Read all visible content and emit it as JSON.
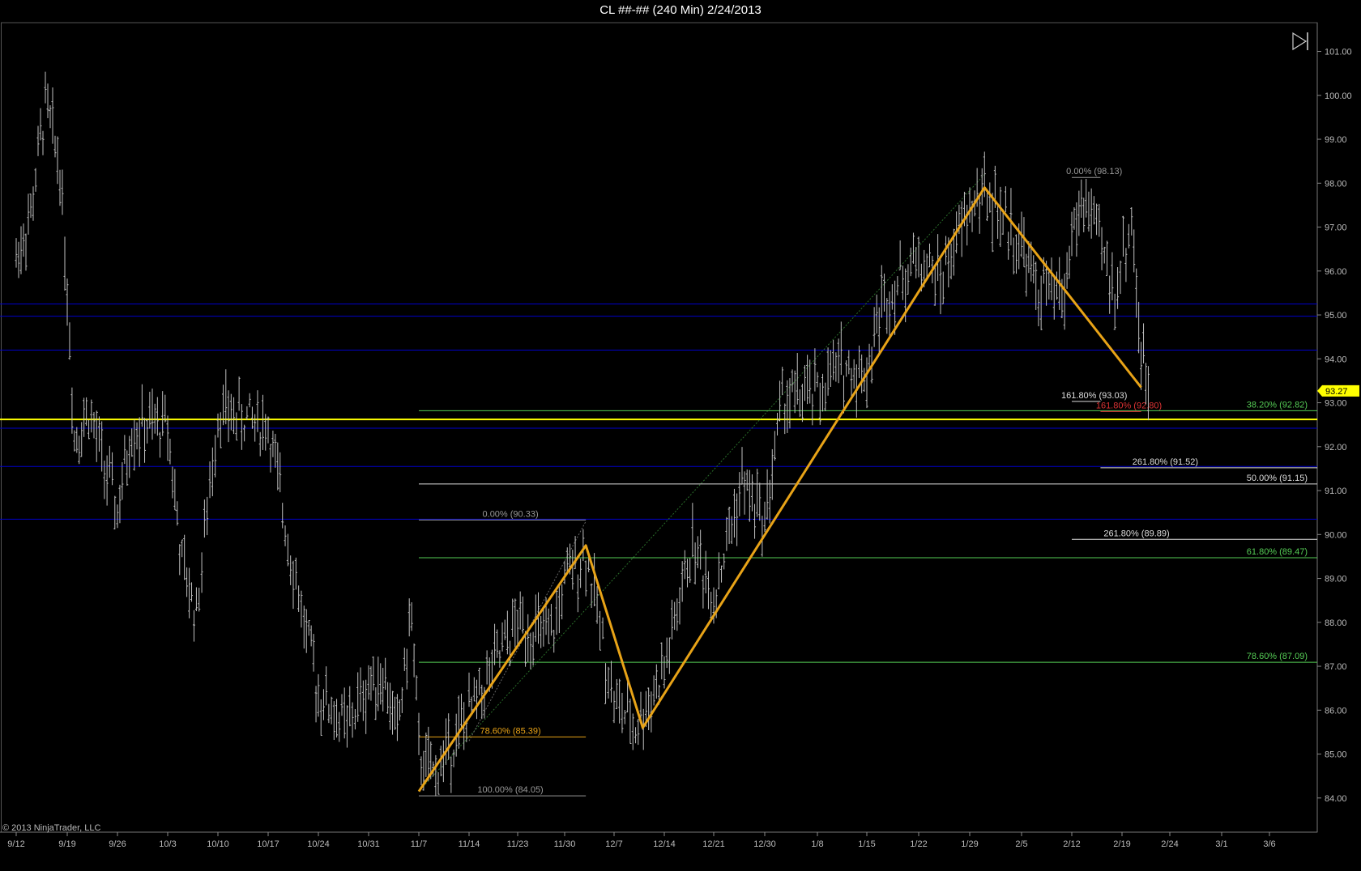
{
  "window": {
    "title": "CL ##-## (240 Min)  2/24/2013"
  },
  "footer": {
    "copyright": "© 2013 NinjaTrader, LLC"
  },
  "price_tag": {
    "value": "93.27",
    "color": "#ffff00"
  },
  "colors": {
    "bars": "#c0c0c0",
    "zigzag": "#e8a317",
    "levels": "#0000cc",
    "yellow_level": "#ffff00",
    "fib_green": "#55cc55",
    "fib_white": "#dddddd",
    "fib_red": "#dd3333"
  },
  "chart_data": {
    "type": "ohlc",
    "title": "CL ##-## (240 Min)  2/24/2013",
    "ylim": [
      83.0,
      101.4
    ],
    "y_ticks": [
      "101.00",
      "100.00",
      "99.00",
      "98.00",
      "97.00",
      "96.00",
      "95.00",
      "94.00",
      "93.00",
      "92.00",
      "91.00",
      "90.00",
      "89.00",
      "88.00",
      "87.00",
      "86.00",
      "85.00",
      "84.00"
    ],
    "x_ticks": [
      "9/12",
      "9/19",
      "9/26",
      "10/3",
      "10/10",
      "10/17",
      "10/24",
      "10/31",
      "11/7",
      "11/14",
      "11/23",
      "11/30",
      "12/7",
      "12/14",
      "12/21",
      "12/30",
      "1/8",
      "1/15",
      "1/22",
      "1/29",
      "2/5",
      "2/12",
      "2/19",
      "2/24",
      "3/1",
      "3/6"
    ],
    "price_path": [
      {
        "x": "9/12",
        "y": 96.3
      },
      {
        "x": "9/14",
        "y": 97.3
      },
      {
        "x": "9/16",
        "y": 99.8
      },
      {
        "x": "9/18",
        "y": 98.4
      },
      {
        "x": "9/19",
        "y": 95.6
      },
      {
        "x": "9/20",
        "y": 92.2
      },
      {
        "x": "9/22",
        "y": 92.8
      },
      {
        "x": "9/26",
        "y": 90.5
      },
      {
        "x": "9/28",
        "y": 92.4
      },
      {
        "x": "10/3",
        "y": 92.5
      },
      {
        "x": "10/5",
        "y": 89.3
      },
      {
        "x": "10/7",
        "y": 88.2
      },
      {
        "x": "10/10",
        "y": 92.8
      },
      {
        "x": "10/17",
        "y": 92.5
      },
      {
        "x": "10/19",
        "y": 90.6
      },
      {
        "x": "10/22",
        "y": 88.0
      },
      {
        "x": "10/24",
        "y": 86.4
      },
      {
        "x": "10/28",
        "y": 85.6
      },
      {
        "x": "10/31",
        "y": 86.6
      },
      {
        "x": "11/2",
        "y": 86.8
      },
      {
        "x": "11/4",
        "y": 85.5
      },
      {
        "x": "11/6",
        "y": 88.2
      },
      {
        "x": "11/7",
        "y": 85.0
      },
      {
        "x": "11/9",
        "y": 84.5
      },
      {
        "x": "11/14",
        "y": 85.9
      },
      {
        "x": "11/23",
        "y": 88.0
      },
      {
        "x": "11/28",
        "y": 87.6
      },
      {
        "x": "11/30",
        "y": 88.9
      },
      {
        "x": "12/3",
        "y": 89.6
      },
      {
        "x": "12/5",
        "y": 87.9
      },
      {
        "x": "12/7",
        "y": 86.2
      },
      {
        "x": "12/10",
        "y": 85.6
      },
      {
        "x": "12/14",
        "y": 86.9
      },
      {
        "x": "12/18",
        "y": 89.8
      },
      {
        "x": "12/21",
        "y": 88.6
      },
      {
        "x": "12/26",
        "y": 91.2
      },
      {
        "x": "12/30",
        "y": 90.3
      },
      {
        "x": "1/2",
        "y": 93.1
      },
      {
        "x": "1/8",
        "y": 93.2
      },
      {
        "x": "1/11",
        "y": 93.8
      },
      {
        "x": "1/15",
        "y": 93.7
      },
      {
        "x": "1/17",
        "y": 95.3
      },
      {
        "x": "1/22",
        "y": 96.3
      },
      {
        "x": "1/25",
        "y": 95.8
      },
      {
        "x": "1/29",
        "y": 97.4
      },
      {
        "x": "1/31",
        "y": 97.8
      },
      {
        "x": "2/5",
        "y": 96.6
      },
      {
        "x": "2/7",
        "y": 95.6
      },
      {
        "x": "2/11",
        "y": 95.4
      },
      {
        "x": "2/12",
        "y": 96.9
      },
      {
        "x": "2/14",
        "y": 97.6
      },
      {
        "x": "2/18",
        "y": 95.5
      },
      {
        "x": "2/20",
        "y": 97.2
      },
      {
        "x": "2/21",
        "y": 94.0
      },
      {
        "x": "2/22",
        "y": 93.2
      }
    ],
    "zigzag": [
      {
        "x": "11/7",
        "y": 84.15
      },
      {
        "x": "12/3",
        "y": 89.75
      },
      {
        "x": "12/11",
        "y": 85.6
      },
      {
        "x": "1/31",
        "y": 97.9
      },
      {
        "x": "2/21",
        "y": 93.35
      }
    ],
    "horizontal_levels": [
      {
        "y": 95.25,
        "color": "#0000cc"
      },
      {
        "y": 94.97,
        "color": "#0000cc"
      },
      {
        "y": 94.2,
        "color": "#0000cc"
      },
      {
        "y": 92.42,
        "color": "#0000cc"
      },
      {
        "y": 91.55,
        "color": "#0000cc"
      },
      {
        "y": 90.35,
        "color": "#0000cc"
      },
      {
        "y": 92.62,
        "color": "#ffff00",
        "width": 2
      }
    ],
    "fib_levels": [
      {
        "label": "38.20% (92.82)",
        "y": 92.82,
        "from": "11/7",
        "color": "#55cc55",
        "label_side": "right"
      },
      {
        "label": "50.00% (91.15)",
        "y": 91.15,
        "from": "11/7",
        "color": "#dddddd",
        "label_side": "right"
      },
      {
        "label": "61.80% (89.47)",
        "y": 89.47,
        "from": "11/7",
        "color": "#55cc55",
        "label_side": "right"
      },
      {
        "label": "78.60% (87.09)",
        "y": 87.09,
        "from": "11/7",
        "color": "#55cc55",
        "label_side": "right"
      },
      {
        "label": "0.00% (90.33)",
        "y": 90.33,
        "from": "11/7",
        "to": "12/3",
        "color": "#999999",
        "label_side": "inline"
      },
      {
        "label": "78.60% (85.39)",
        "y": 85.39,
        "from": "11/7",
        "to": "12/3",
        "color": "#e8a317",
        "label_side": "inline"
      },
      {
        "label": "100.00% (84.05)",
        "y": 84.05,
        "from": "11/7",
        "to": "12/3",
        "color": "#999999",
        "label_side": "inline"
      },
      {
        "label": "0.00% (98.13)",
        "y": 98.13,
        "from": "2/12",
        "to": "2/16",
        "color": "#999999",
        "label_side": "inline"
      },
      {
        "label": "161.80% (93.03)",
        "y": 93.03,
        "from": "2/12",
        "to": "2/16",
        "color": "#dddddd",
        "label_side": "inline"
      },
      {
        "label": "161.80% (92.80)",
        "y": 92.8,
        "from": "2/16",
        "to": "2/21",
        "color": "#dd3333",
        "label_side": "inline"
      },
      {
        "label": "261.80% (91.52)",
        "y": 91.52,
        "from": "2/16",
        "color": "#dddddd",
        "label_side": "inline"
      },
      {
        "label": "261.80% (89.89)",
        "y": 89.89,
        "from": "2/12",
        "color": "#dddddd",
        "label_side": "inline"
      }
    ]
  }
}
